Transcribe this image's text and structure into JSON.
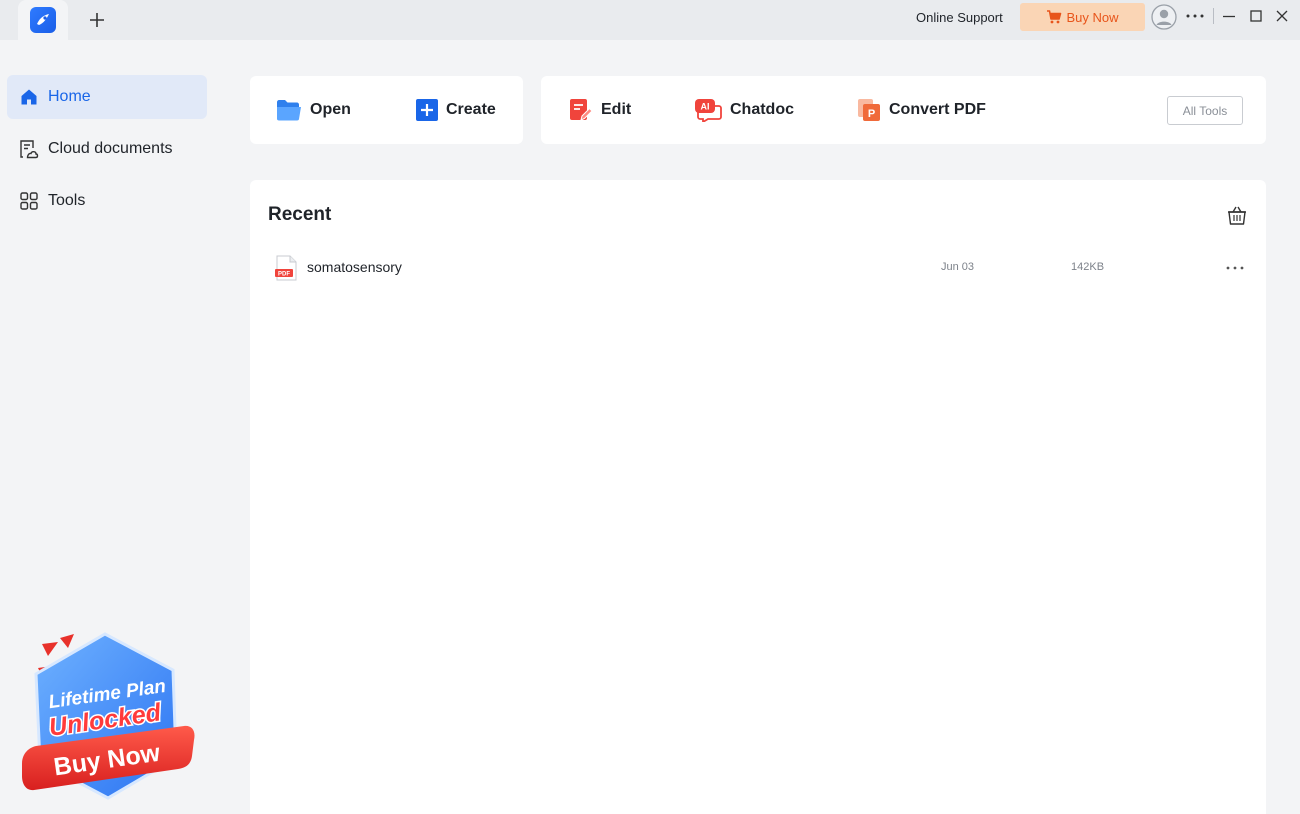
{
  "titlebar": {
    "online_support": "Online Support",
    "buy_now": "Buy Now",
    "icons": [
      "app-logo-icon",
      "plus-icon",
      "cart-icon",
      "user-icon",
      "more-icon",
      "minimize-icon",
      "maximize-icon",
      "close-icon"
    ]
  },
  "sidebar": {
    "items": [
      {
        "label": "Home",
        "icon": "home-icon",
        "active": true
      },
      {
        "label": "Cloud documents",
        "icon": "cloud-document-icon",
        "active": false
      },
      {
        "label": "Tools",
        "icon": "tools-grid-icon",
        "active": false
      }
    ],
    "promo": {
      "line1": "Lifetime Plan",
      "line2": "Unlocked",
      "button": "Buy Now"
    }
  },
  "quick_actions": {
    "open": "Open",
    "create": "Create",
    "edit": "Edit",
    "chatdoc": "Chatdoc",
    "chatdoc_badge": "AI",
    "convert": "Convert PDF",
    "convert_badge": "P",
    "all_tools": "All Tools"
  },
  "recent": {
    "title": "Recent",
    "files": [
      {
        "name": "somatosensory",
        "type_badge": "PDF",
        "date": "Jun 03",
        "size": "142KB"
      }
    ]
  },
  "colors": {
    "accent": "#1a66e8",
    "buy_bg": "#fad5b5",
    "buy_text": "#e8551b",
    "edit_red": "#f0443c",
    "convert_orange": "#f06a3a"
  }
}
